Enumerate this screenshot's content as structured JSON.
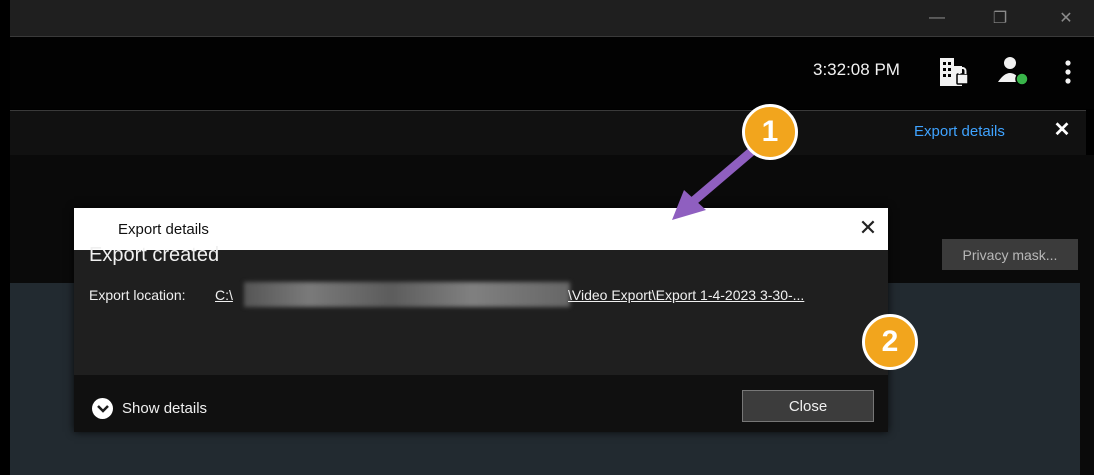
{
  "titlebar": {
    "minimize_label": "—",
    "restore_label": "❐",
    "close_label": "✕"
  },
  "toolbar": {
    "clock": "3:32:08 PM"
  },
  "notification": {
    "link_label": "Export details",
    "close_label": "✕"
  },
  "workspace": {
    "privacy_mask_label": "Privacy mask..."
  },
  "dialog": {
    "title": "Export details",
    "close_label": "✕",
    "heading": "Export created",
    "location_label": "Export location:",
    "location_drive": "C:\\",
    "location_path": "\\Video Export\\Export 1-4-2023 3-30-...",
    "show_details_label": "Show details",
    "close_button_label": "Close"
  },
  "annotations": {
    "badge1": "1",
    "badge2": "2",
    "color": "#f2a51d",
    "arrow_color": "#8f5fc0"
  },
  "icons": [
    "building-lock-icon",
    "user-status-icon",
    "more-vertical-icon",
    "chevron-down-icon"
  ]
}
